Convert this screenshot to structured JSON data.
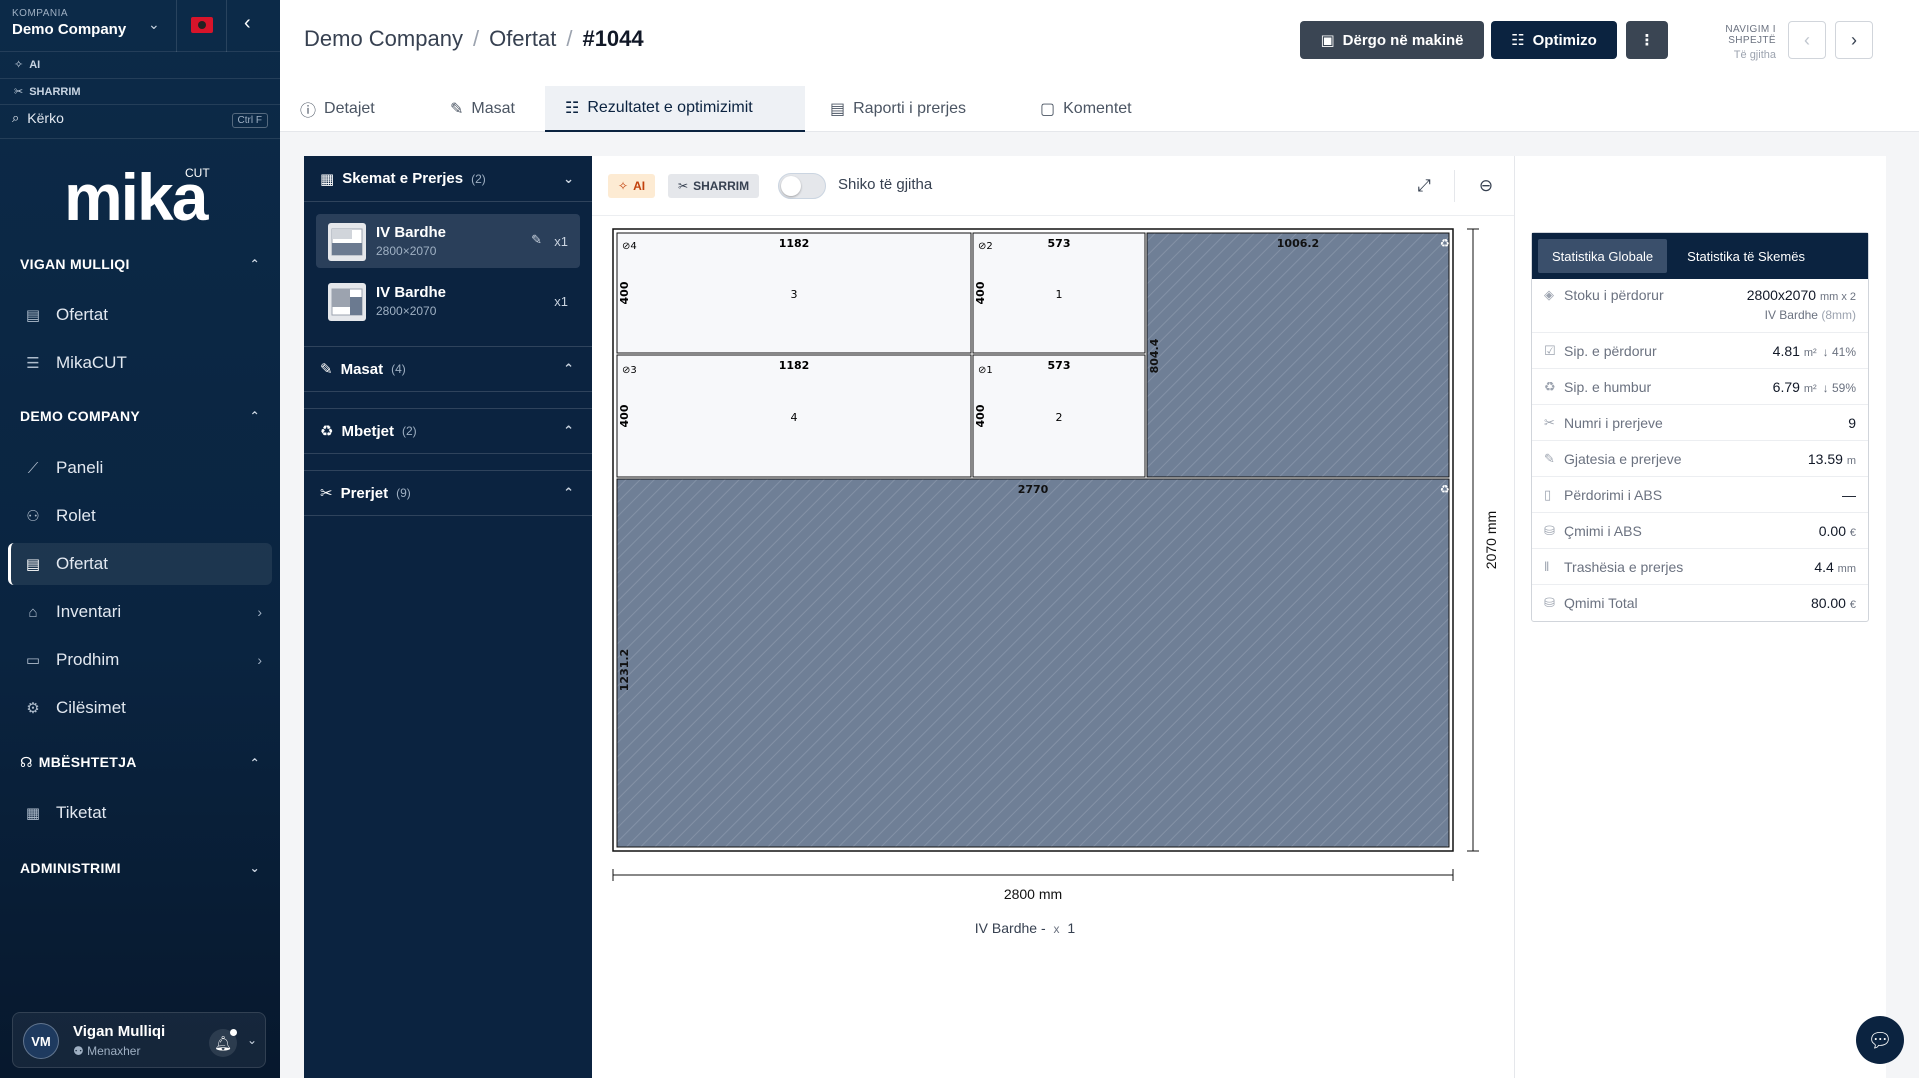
{
  "sidebar": {
    "company_label": "KOMPANIA",
    "company_name": "Demo Company",
    "ai_label": "AI",
    "cut_label": "SHARRIM",
    "search_placeholder": "Kërko",
    "search_shortcut": "Ctrl F",
    "logo_text": "mika",
    "logo_sup": "CUT",
    "sections": [
      {
        "title": "VIGAN MULLIQI",
        "items": [
          {
            "label": "Ofertat",
            "icon": "document-icon"
          },
          {
            "label": "MikaCUT",
            "icon": "list-icon"
          }
        ]
      },
      {
        "title": "DEMO COMPANY",
        "items": [
          {
            "label": "Paneli",
            "icon": "chart-icon"
          },
          {
            "label": "Rolet",
            "icon": "users-icon"
          },
          {
            "label": "Ofertat",
            "icon": "document-icon"
          },
          {
            "label": "Inventari",
            "icon": "warehouse-icon"
          },
          {
            "label": "Prodhim",
            "icon": "folder-icon"
          },
          {
            "label": "Cilësimet",
            "icon": "gear-icon"
          }
        ]
      },
      {
        "title": "MBËSHTETJA",
        "items": [
          {
            "label": "Tiketat",
            "icon": "ticket-icon"
          }
        ]
      },
      {
        "title": "ADMINISTRIMI",
        "items": []
      }
    ],
    "user": {
      "initials": "VM",
      "name": "Vigan Mulliqi",
      "role": "Menaxher"
    }
  },
  "header": {
    "breadcrumb": [
      "Demo Company",
      "Ofertat",
      "#1044"
    ],
    "send_button": "Dërgo në makinë",
    "optimize_button": "Optimizo",
    "quick_nav_title": "NAVIGIM I SHPEJTË",
    "quick_nav_sub": "Të gjitha"
  },
  "tabs": [
    "Detajet",
    "Masat",
    "Rezultatet e optimizimit",
    "Raporti i prerjes",
    "Komentet"
  ],
  "left_panel": {
    "schemes_title": "Skemat e Prerjes",
    "schemes_count": "(2)",
    "schemes": [
      {
        "name": "IV Bardhe",
        "dims": "2800×2070",
        "qty": "x1"
      },
      {
        "name": "IV Bardhe",
        "dims": "2800×2070",
        "qty": "x1"
      }
    ],
    "masat_title": "Masat",
    "masat_count": "(4)",
    "mbetjet_title": "Mbetjet",
    "mbetjet_count": "(2)",
    "prerjet_title": "Prerjet",
    "prerjet_count": "(9)"
  },
  "toolbar": {
    "ai_chip": "AI",
    "cut_chip": "SHARRIM",
    "toggle_label": "Shiko të gjitha"
  },
  "drawing": {
    "width_label": "2800 mm",
    "height_label": "2070 mm",
    "caption": "IV Bardhe -",
    "caption_qty": "x",
    "caption_count": "1",
    "pieces": [
      {
        "tag": "4",
        "width": "1182",
        "height": "400",
        "num": "3"
      },
      {
        "tag": "2",
        "width": "573",
        "height": "400",
        "num": "1"
      },
      {
        "tag": "3",
        "width": "1182",
        "height": "400",
        "num": "4"
      },
      {
        "tag": "1",
        "width": "573",
        "height": "400",
        "num": "2"
      }
    ],
    "waste": [
      {
        "width": "1006.2",
        "height": "804.4"
      },
      {
        "width": "2770",
        "height": "1231.2"
      }
    ]
  },
  "stats": {
    "tab_global": "Statistika Globale",
    "tab_scheme": "Statistika të Skemës",
    "rows": [
      {
        "label": "Stoku i përdorur",
        "value": "2800x2070",
        "unit": "mm x 2",
        "extra": "IV Bardhe",
        "extra2": "(8mm)"
      },
      {
        "label": "Sip. e përdorur",
        "value": "4.81",
        "unit": "m²",
        "pct": "↓ 41%"
      },
      {
        "label": "Sip. e humbur",
        "value": "6.79",
        "unit": "m²",
        "pct": "↓ 59%"
      },
      {
        "label": "Numri i prerjeve",
        "value": "9"
      },
      {
        "label": "Gjatesia e prerjeve",
        "value": "13.59",
        "unit": "m"
      },
      {
        "label": "Përdorimi i ABS",
        "value": "—"
      },
      {
        "label": "Çmimi i ABS",
        "value": "0.00",
        "unit": "€"
      },
      {
        "label": "Trashësia e prerjes",
        "value": "4.4",
        "unit": "mm"
      },
      {
        "label": "Qmimi Total",
        "value": "80.00",
        "unit": "€"
      }
    ]
  }
}
